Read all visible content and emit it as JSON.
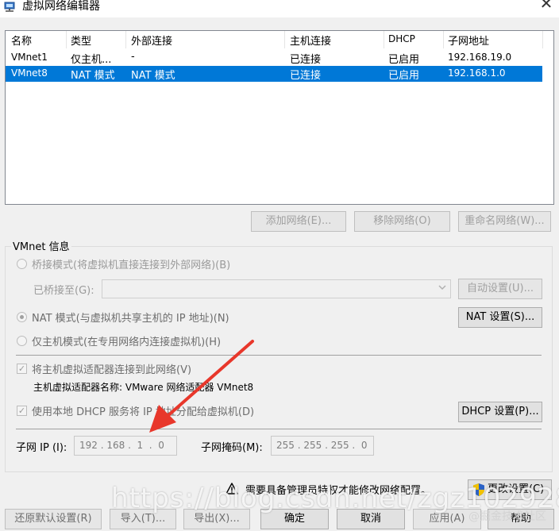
{
  "window": {
    "title": "虚拟网络编辑器",
    "close_glyph": "✕"
  },
  "table": {
    "headers": [
      "名称",
      "类型",
      "外部连接",
      "主机连接",
      "DHCP",
      "子网地址"
    ],
    "rows": [
      {
        "name": "VMnet1",
        "type": "仅主机...",
        "external": "-",
        "host": "已连接",
        "dhcp": "已启用",
        "subnet": "192.168.19.0",
        "selected": false
      },
      {
        "name": "VMnet8",
        "type": "NAT 模式",
        "external": "NAT 模式",
        "host": "已连接",
        "dhcp": "已启用",
        "subnet": "192.168.1.0",
        "selected": true
      }
    ]
  },
  "table_buttons": {
    "add": "添加网络(E)...",
    "remove": "移除网络(O)",
    "rename": "重命名网络(W)..."
  },
  "vmnet_info": {
    "group_label": "VMnet 信息",
    "bridged_label": "桥接模式(将虚拟机直接连接到外部网络)(B)",
    "bridged_to_label": "已桥接至(G):",
    "auto_settings": "自动设置(U)...",
    "nat_label": "NAT 模式(与虚拟机共享主机的 IP 地址)(N)",
    "nat_settings": "NAT 设置(S)...",
    "host_only_label": "仅主机模式(在专用网络内连接虚拟机)(H)",
    "connect_adapter_label": "将主机虚拟适配器连接到此网络(V)",
    "adapter_name": "主机虚拟适配器名称: VMware 网络适配器 VMnet8",
    "dhcp_label": "使用本地 DHCP 服务将 IP 地址分配给虚拟机(D)",
    "dhcp_settings": "DHCP 设置(P)...",
    "subnet_ip_label": "子网 IP (I):",
    "subnet_ip_value": "192 . 168 .  1  .  0",
    "subnet_mask_label": "子网掩码(M):",
    "subnet_mask_value": "255 . 255 . 255 .  0"
  },
  "admin_notice": "需要具备管理员特权才能修改网络配置。",
  "change_settings": "更改设置(C)",
  "footer_buttons": {
    "restore": "还原默认设置(R)",
    "import": "导入(T)...",
    "export": "导出(X)...",
    "ok": "确定",
    "cancel": "取消",
    "apply": "应用(A)",
    "help": "帮助"
  },
  "watermark": "https://blog.csdn.net/zgz102928",
  "watermark_small": "@掘金技术社区",
  "colors": {
    "selection": "#0078d7",
    "arrow": "#e8372b",
    "disabled_text": "#9a9a9a"
  }
}
